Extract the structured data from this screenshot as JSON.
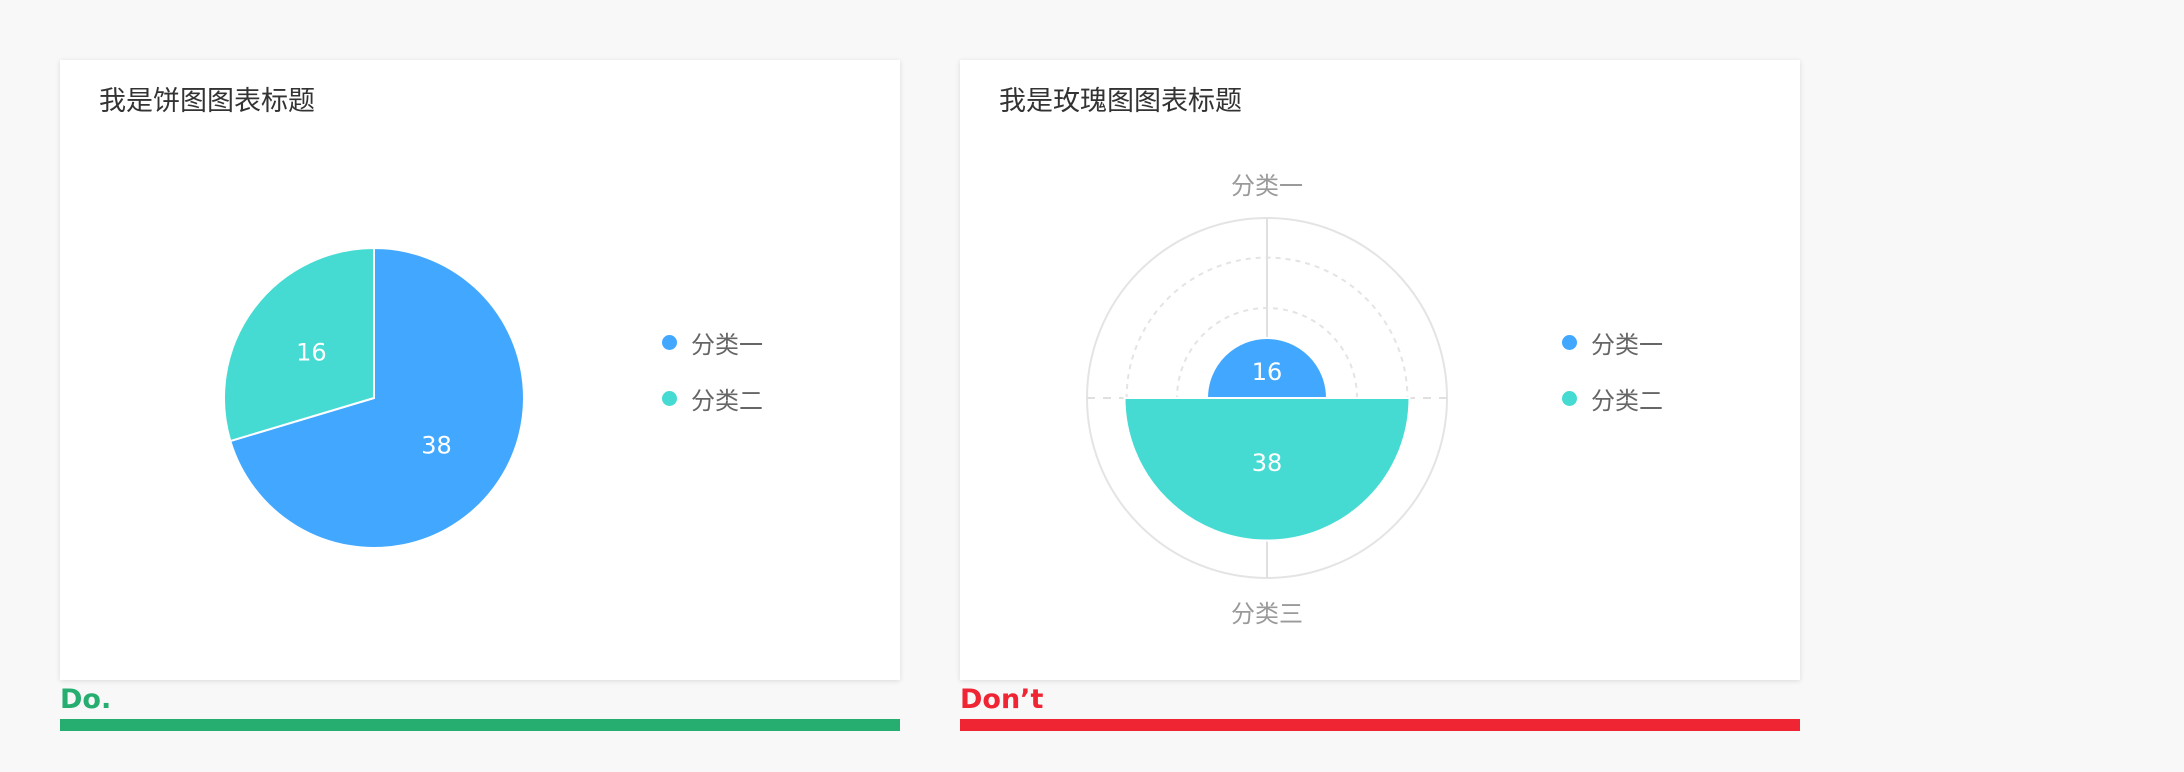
{
  "colors": {
    "series_1": "#42a8ff",
    "series_2": "#45dbd3",
    "do": "#25ae6f",
    "dont": "#f02533"
  },
  "do_caption": "Do.",
  "dont_caption": "Don’t",
  "chart_data": [
    {
      "type": "pie",
      "title": "我是饼图图表标题",
      "categories": [
        "分类一",
        "分类二"
      ],
      "values": [
        38,
        16
      ],
      "legend": "right"
    },
    {
      "type": "rose",
      "title": "我是玫瑰图图表标题",
      "axis_labels": [
        "分类一",
        "分类三"
      ],
      "series": [
        {
          "name": "分类一",
          "value": 16
        },
        {
          "name": "分类二",
          "value": 38
        }
      ],
      "radial_max": 48,
      "legend": "right"
    }
  ]
}
